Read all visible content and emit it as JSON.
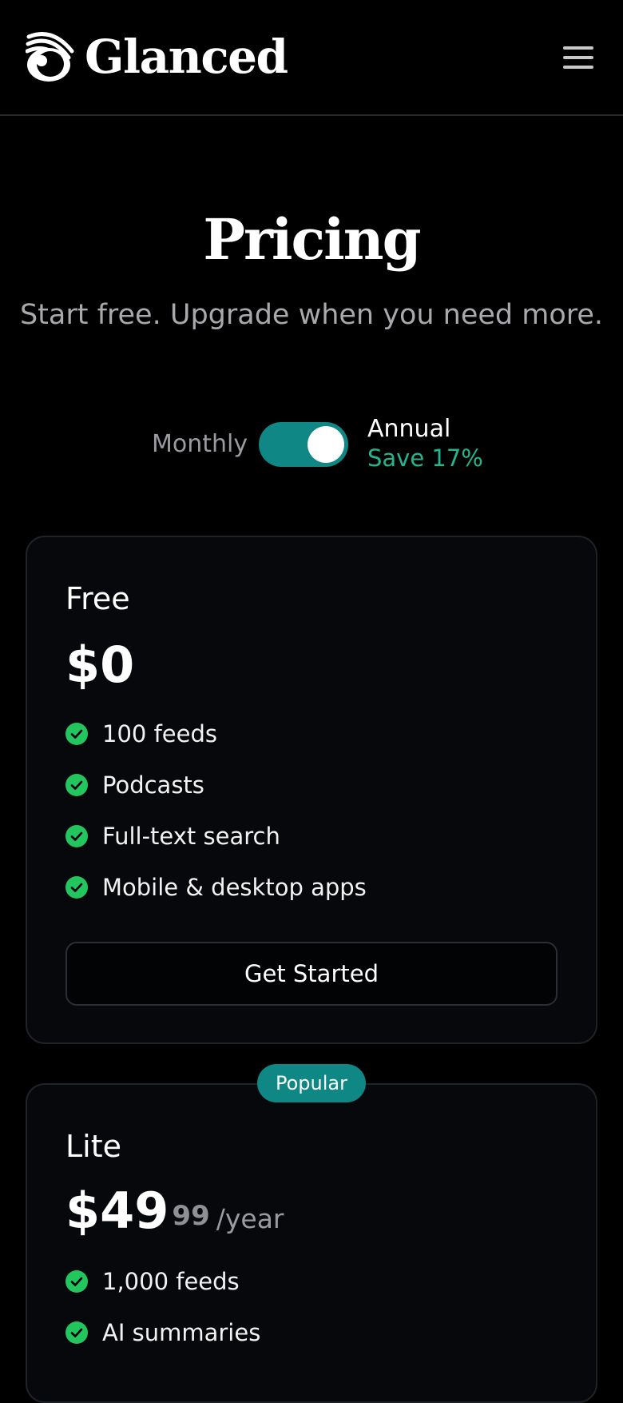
{
  "header": {
    "brand": "Glanced",
    "logo_icon": "swirl-eye-icon",
    "menu_icon": "hamburger-menu-icon"
  },
  "hero": {
    "title": "Pricing",
    "subtitle": "Start free. Upgrade when you need more."
  },
  "billing_toggle": {
    "monthly_label": "Monthly",
    "annual_label": "Annual",
    "save_label": "Save 17%",
    "selected": "Annual",
    "accent_color": "#0e8785",
    "save_color": "#21b690"
  },
  "plans": [
    {
      "name": "Free",
      "price": "$0",
      "features": [
        "100 feeds",
        "Podcasts",
        "Full-text search",
        "Mobile & desktop apps"
      ],
      "cta_label": "Get Started"
    },
    {
      "name": "Lite",
      "badge": "Popular",
      "price_whole": "$49",
      "price_cents": "99",
      "price_period": "/year",
      "features": [
        "1,000 feeds",
        "AI summaries"
      ]
    }
  ],
  "colors": {
    "background": "#000000",
    "card_background": "#06080b",
    "check": "#22c55e"
  }
}
